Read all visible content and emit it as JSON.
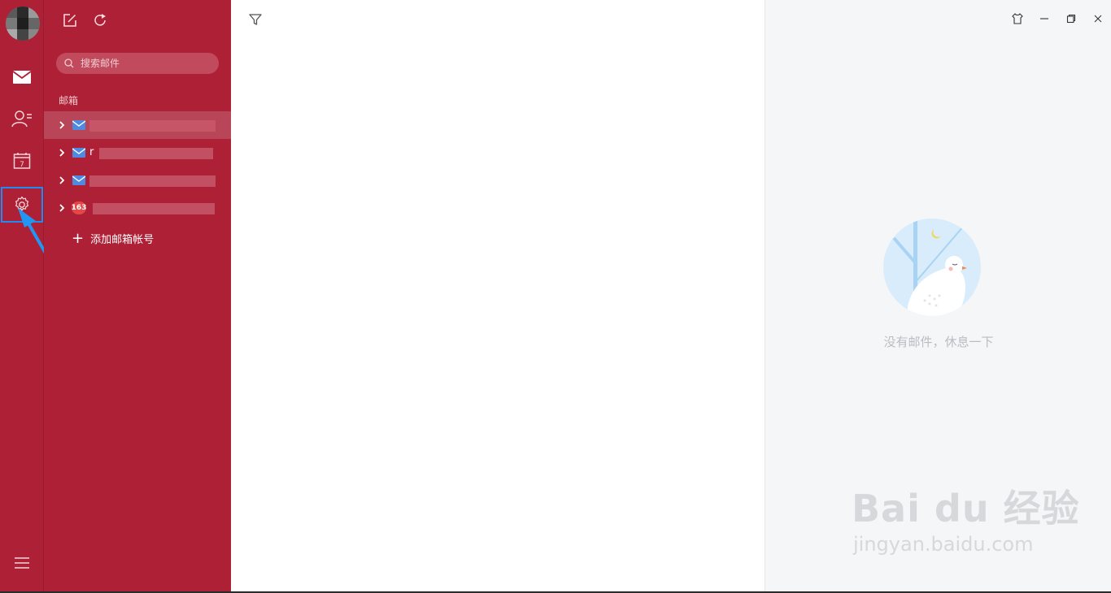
{
  "rail": {
    "items": [
      {
        "id": "mail",
        "icon": "mail-icon"
      },
      {
        "id": "contacts",
        "icon": "contacts-icon"
      },
      {
        "id": "calendar",
        "icon": "calendar-icon",
        "day": "7"
      },
      {
        "id": "settings",
        "icon": "gear-icon"
      }
    ],
    "menu_icon": "hamburger-menu-icon"
  },
  "toolbar": {
    "compose_icon": "compose-icon",
    "refresh_icon": "refresh-icon"
  },
  "search": {
    "placeholder": "搜索邮件"
  },
  "mailbox": {
    "section_label": "邮箱",
    "accounts": [
      {
        "icon": "mail-icon",
        "visible_text": "",
        "active": true
      },
      {
        "icon": "mail-icon",
        "visible_text": "r",
        "active": false
      },
      {
        "icon": "mail-icon",
        "visible_text": "",
        "active": false
      },
      {
        "icon": "163-icon",
        "badge": "163",
        "visible_text": "",
        "active": false
      }
    ],
    "add_account_label": "添加邮箱帐号"
  },
  "list": {
    "filter_icon": "filter-icon"
  },
  "reading": {
    "empty_text": "没有邮件，休息一下",
    "window_buttons": [
      "skin-icon",
      "minimize-icon",
      "restore-icon",
      "close-icon"
    ]
  },
  "watermark": {
    "brand": "Bai du 经验",
    "url": "jingyan.baidu.com"
  },
  "colors": {
    "sidebar_bg": "#ae2036",
    "highlight_border": "#1e8cf0",
    "reading_bg": "#f5f6f8"
  }
}
